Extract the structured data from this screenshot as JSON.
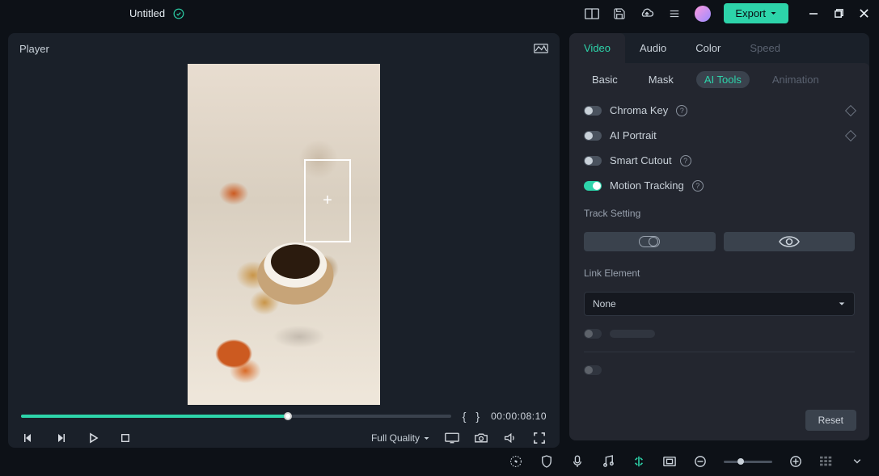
{
  "header": {
    "title": "Untitled",
    "export_label": "Export"
  },
  "player": {
    "label": "Player",
    "timecode": "00:00:08:10",
    "quality_label": "Full Quality"
  },
  "tabs": {
    "video": "Video",
    "audio": "Audio",
    "color": "Color",
    "speed": "Speed"
  },
  "subtabs": {
    "basic": "Basic",
    "mask": "Mask",
    "ai_tools": "AI Tools",
    "animation": "Animation"
  },
  "ai_tools": {
    "chroma_key": "Chroma Key",
    "ai_portrait": "AI Portrait",
    "smart_cutout": "Smart Cutout",
    "motion_tracking": "Motion Tracking",
    "track_setting": "Track Setting",
    "link_element": "Link Element",
    "link_element_value": "None"
  },
  "footer": {
    "reset": "Reset"
  }
}
